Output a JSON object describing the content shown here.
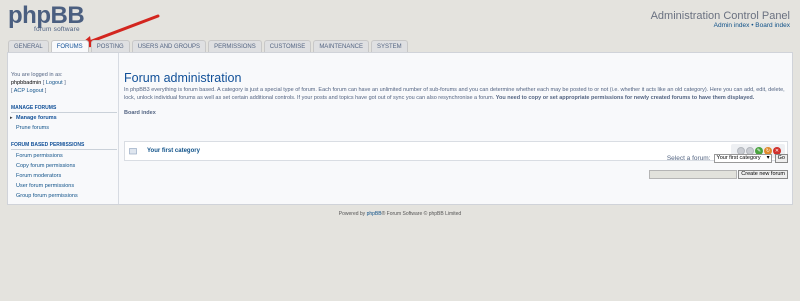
{
  "header": {
    "logo_text": "phpBB",
    "logo_sub": "forum software",
    "title": "Administration Control Panel",
    "admin_index": "Admin index",
    "sep": " • ",
    "board_index": "Board index"
  },
  "tabs": [
    {
      "label": "GENERAL",
      "active": false
    },
    {
      "label": "FORUMS",
      "active": true
    },
    {
      "label": "POSTING",
      "active": false
    },
    {
      "label": "USERS AND GROUPS",
      "active": false
    },
    {
      "label": "PERMISSIONS",
      "active": false
    },
    {
      "label": "CUSTOMISE",
      "active": false
    },
    {
      "label": "MAINTENANCE",
      "active": false
    },
    {
      "label": "SYSTEM",
      "active": false
    }
  ],
  "sidebar": {
    "logged_in_as": "You are logged in as:",
    "username": "phpbbadmin",
    "logout": "Logout",
    "acp_logout": "ACP Logout",
    "section1": "MANAGE FORUMS",
    "manage_forums": "Manage forums",
    "prune_forums": "Prune forums",
    "section2": "FORUM BASED PERMISSIONS",
    "perm_items": [
      "Forum permissions",
      "Copy forum permissions",
      "Forum moderators",
      "User forum permissions",
      "Group forum permissions"
    ]
  },
  "main": {
    "title": "Forum administration",
    "desc": "In phpBB3 everything is forum based. A category is just a special type of forum. Each forum can have an unlimited number of sub-forums and you can determine whether each may be posted to or not (i.e. whether it acts like an old category). Here you can add, edit, delete, lock, unlock individual forums as well as set certain additional controls. If your posts and topics have got out of sync you can also resynchronise a forum.",
    "desc_bold": "You need to copy or set appropriate permissions for newly created forums to have them displayed.",
    "board_index": "Board index",
    "category": "Your first category",
    "select_label": "Select a forum:",
    "select_value": "Your first category",
    "go_button": "Go",
    "create_button": "Create new forum"
  },
  "footer": {
    "powered_by": "Powered by",
    "phpbb": "phpBB",
    "rest": "® Forum Software © phpBB Limited"
  },
  "colors": {
    "background": "#e4e3de",
    "panel": "#f8f9fb",
    "link": "#105289",
    "accent": "#115098",
    "arrow": "#d3261f"
  }
}
